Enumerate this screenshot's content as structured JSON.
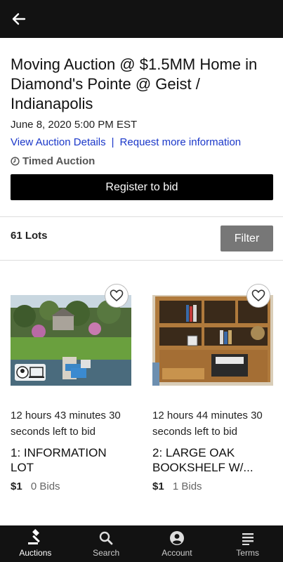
{
  "header": {
    "title": "Moving Auction @ $1.5MM Home in Diamond's Pointe @ Geist / Indianapolis",
    "date": "June 8, 2020 5:00 PM EST",
    "view_details_link": "View Auction Details",
    "separator": "|",
    "request_info_link": "Request more information",
    "auction_type": "Timed Auction",
    "register_button": "Register to bid"
  },
  "lots_bar": {
    "count_label": "61 Lots",
    "filter_button": "Filter"
  },
  "lots": [
    {
      "time_left": "12 hours 43 minutes 30 seconds left to bid",
      "title": "1: INFORMATION LOT",
      "price": "$1",
      "bids": "0 Bids"
    },
    {
      "time_left": "12 hours 44 minutes 30 seconds left to bid",
      "title": "2: LARGE OAK BOOKSHELF W/...",
      "price": "$1",
      "bids": "1 Bids"
    }
  ],
  "bottom_nav": [
    {
      "label": "Auctions",
      "icon": "gavel-icon",
      "active": true
    },
    {
      "label": "Search",
      "icon": "search-icon",
      "active": false
    },
    {
      "label": "Account",
      "icon": "account-icon",
      "active": false
    },
    {
      "label": "Terms",
      "icon": "terms-icon",
      "active": false
    }
  ]
}
